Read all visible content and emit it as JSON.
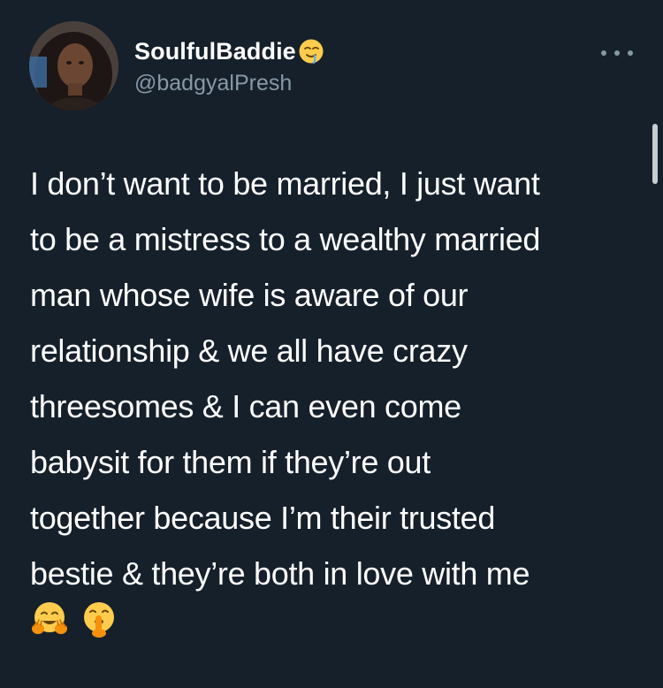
{
  "tweet": {
    "author": {
      "display_name": "SoulfulBaddie",
      "name_emoji": "drooling-face-icon",
      "handle": "@badgyalPresh"
    },
    "text_lines": [
      "I don’t want to be married, I just want",
      "to be a mistress to a wealthy married",
      "man whose wife is aware of our",
      "relationship & we all have crazy",
      "threesomes & I can even come",
      "babysit for them if they’re out",
      "together because I’m their trusted",
      "bestie & they’re both in love with me"
    ],
    "trailing_emojis": [
      "hugging-face-icon",
      "shushing-face-icon"
    ]
  },
  "colors": {
    "background": "#15202b",
    "text_primary": "#ffffff",
    "text_secondary": "#8899a6"
  }
}
